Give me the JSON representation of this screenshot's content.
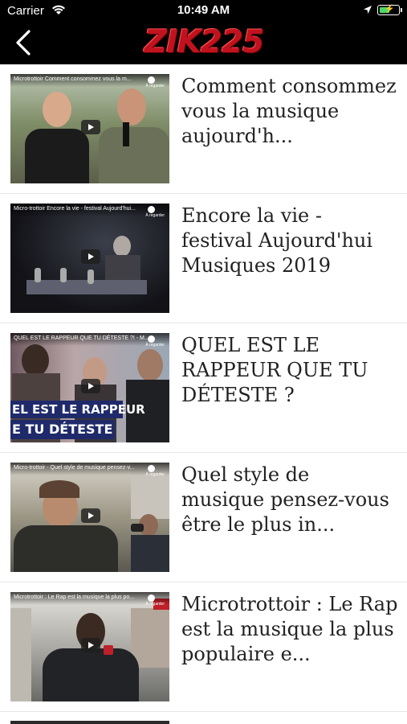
{
  "status_bar": {
    "carrier": "Carrier",
    "time": "10:49 AM"
  },
  "header": {
    "logo_text": "ZIK225",
    "back_icon": "chevron-left-icon"
  },
  "articles": [
    {
      "title": "Comment consommez vous la musique aujourd'h...",
      "thumb_caption": "Microtrottoir Comment consommez vous la m...",
      "thumb_badge": "À regarder"
    },
    {
      "title": "Encore la vie - festival Aujourd'hui Musiques 2019",
      "thumb_caption": "Micro-trottoir Encore la vie - festival Aujourd'hui...",
      "thumb_badge": "À regarder"
    },
    {
      "title": "QUEL EST LE RAPPEUR QUE TU DÉTESTE ?",
      "thumb_caption": "QUEL EST LE RAPPEUR QUE TU DÉTESTE ?! - M...",
      "thumb_badge": "À regarder",
      "thumb_overlay_1": "EL EST LE RAPPEUR",
      "thumb_overlay_2": "E TU DÉTESTE"
    },
    {
      "title": "Quel style de musique pensez-vous être le plus in...",
      "thumb_caption": "Micro-trottoir - Quel style de musique pensez-v...",
      "thumb_badge": "À regarder"
    },
    {
      "title": "Microtrottoir : Le Rap est la musique la plus populaire e...",
      "thumb_caption": "Microtrottoir : Le Rap est la musique la plus po...",
      "thumb_badge": "À regarder"
    }
  ],
  "colors": {
    "header_bg": "#000000",
    "logo_red": "#c1121f",
    "battery_green": "#4cd964",
    "divider": "#e6e6e6"
  }
}
